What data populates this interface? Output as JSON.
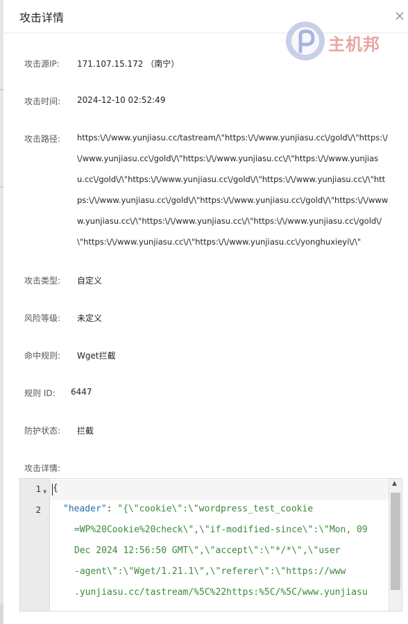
{
  "dialog": {
    "title": "攻击详情"
  },
  "logo": {
    "text": "主机邦",
    "icon": "p-logo-icon"
  },
  "fields": [
    {
      "label": "攻击源IP:",
      "value": "171.107.15.172 （南宁）"
    },
    {
      "label": "攻击时间:",
      "value": "2024-12-10 02:52:49"
    },
    {
      "label": "攻击路径:",
      "lines": [
        "https:\\/\\/www.yunjiasu.cc/tastream/\\\"https:\\/\\/www.yunjiasu.cc\\/gold\\/\\\"https:\\/",
        "\\/www.yunjiasu.cc\\/gold\\/\\\"https:\\/\\/www.yunjiasu.cc\\/\\\"https:\\/\\/www.yunjias",
        "u.cc\\/gold\\/\\\"https:\\/\\/www.yunjiasu.cc\\/gold\\/\\\"https:\\/\\/www.yunjiasu.cc\\/\\\"htt",
        "ps:\\/\\/www.yunjiasu.cc\\/gold\\/\\\"https:\\/\\/www.yunjiasu.cc\\/gold\\/\\\"https:\\/\\/www",
        "w.yunjiasu.cc\\/\\\"https:\\/\\/www.yunjiasu.cc\\/\\\"https:\\/\\/www.yunjiasu.cc\\/gold\\/",
        "\\\"https:\\/\\/www.yunjiasu.cc\\/\\\"https:\\/\\/www.yunjiasu.cc\\/yonghuxieyi\\/\\\""
      ]
    },
    {
      "label": "攻击类型:",
      "value": "自定义"
    },
    {
      "label": "风险等级:",
      "value": "未定义"
    },
    {
      "label": "命中规则:",
      "value": "Wget拦截"
    },
    {
      "label": "规则 ID:",
      "value": "6447"
    },
    {
      "label": "防护状态:",
      "value": "拦截"
    },
    {
      "label": "攻击详情:"
    }
  ],
  "editor": {
    "line_numbers": [
      "1",
      "2"
    ],
    "line1": "{",
    "line2_key": "\"header\"",
    "line2_colon": ": ",
    "line2_wrap1": "\"{\\\"cookie\\\":\\\"wordpress_test_cookie",
    "line2_wrap2": "=WP%20Cookie%20check\\\",\\\"if-modified-since\\\":\\\"Mon, 09",
    "line2_wrap3": "Dec 2024 12:56:50 GMT\\\",\\\"accept\\\":\\\"*/*\\\",\\\"user",
    "line2_wrap4": "-agent\\\":\\\"Wget/1.21.1\\\",\\\"referer\\\":\\\"https://www",
    "line2_wrap5": ".yunjiasu.cc/tastream/%5C%22https:%5C/%5C/www.yunjiasu"
  }
}
